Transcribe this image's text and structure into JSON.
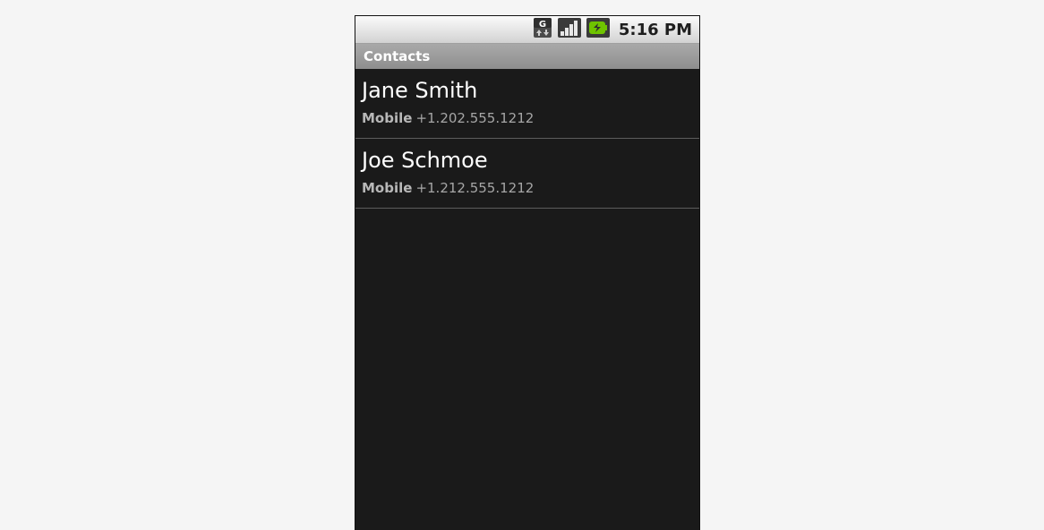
{
  "status_bar": {
    "time": "5:16 PM",
    "icons": [
      "gprs-data-icon",
      "signal-strength-icon",
      "battery-charging-icon"
    ],
    "data_icon_letter": "G"
  },
  "app": {
    "title": "Contacts"
  },
  "contacts": [
    {
      "name": "Jane Smith",
      "type": "Mobile",
      "number": "+1.202.555.1212"
    },
    {
      "name": "Joe Schmoe",
      "type": "Mobile",
      "number": "+1.212.555.1212"
    }
  ],
  "colors": {
    "background": "#1a1a1a",
    "title_bar": "#9a9a9a",
    "battery_green": "#6fc400"
  }
}
